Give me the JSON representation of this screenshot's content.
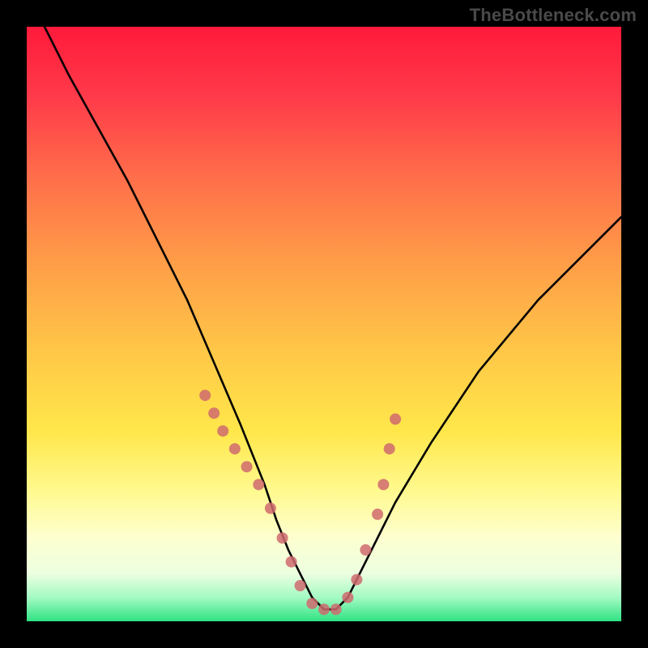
{
  "watermark": "TheBottleneck.com",
  "chart_data": {
    "type": "line",
    "title": "",
    "xlabel": "",
    "ylabel": "",
    "xlim": [
      0,
      100
    ],
    "ylim": [
      0,
      100
    ],
    "series": [
      {
        "name": "bottleneck-curve",
        "x": [
          3,
          7,
          12,
          17,
          22,
          27,
          30,
          33,
          36,
          38,
          40,
          42,
          44,
          46,
          48,
          50,
          52,
          54,
          56,
          58,
          62,
          68,
          76,
          86,
          100
        ],
        "values": [
          100,
          92,
          83,
          74,
          64,
          54,
          47,
          40,
          33,
          28,
          23,
          17,
          12,
          8,
          4,
          2,
          2,
          4,
          8,
          12,
          20,
          30,
          42,
          54,
          68
        ]
      }
    ],
    "markers": {
      "name": "sample-points",
      "color": "#cf6a6e",
      "x": [
        30,
        31.5,
        33,
        35,
        37,
        39,
        41,
        43,
        44.5,
        46,
        48,
        50,
        52,
        54,
        55.5,
        57,
        59,
        60,
        61,
        62
      ],
      "values": [
        38,
        35,
        32,
        29,
        26,
        23,
        19,
        14,
        10,
        6,
        3,
        2,
        2,
        4,
        7,
        12,
        18,
        23,
        29,
        34
      ]
    },
    "gradient_stops": [
      {
        "pos": 0,
        "color": "#ff1a3b"
      },
      {
        "pos": 25,
        "color": "#ff6d4a"
      },
      {
        "pos": 55,
        "color": "#ffc847"
      },
      {
        "pos": 78,
        "color": "#fff98e"
      },
      {
        "pos": 100,
        "color": "#2fe283"
      }
    ]
  }
}
